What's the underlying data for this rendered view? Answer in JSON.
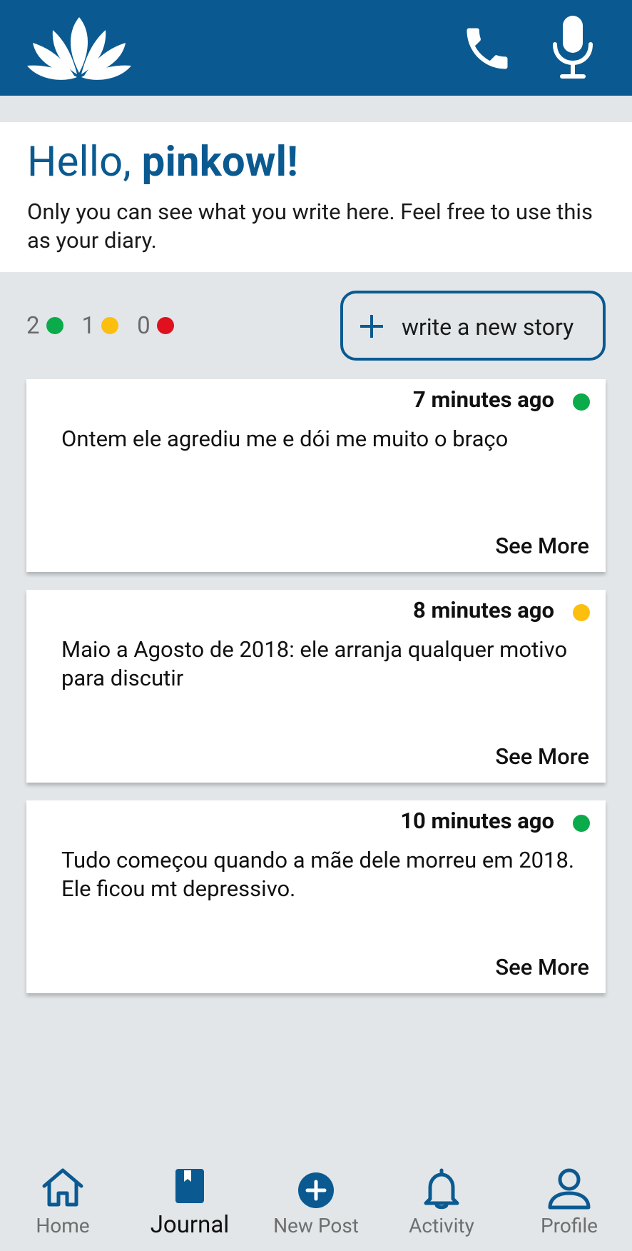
{
  "colors": {
    "brand": "#0a5a91",
    "background": "#e2e6e9",
    "green": "#0bab4b",
    "yellow": "#fcbf0f",
    "red": "#e0101e"
  },
  "header": {
    "logo_icon": "lotus-icon",
    "call_icon": "phone-icon",
    "voice_icon": "microphone-icon"
  },
  "greeting": {
    "hello": "Hello, ",
    "username": "pinkowl!",
    "subtitle": "Only you can see what you write here. Feel free to use this as your diary."
  },
  "counters": [
    {
      "count": "2",
      "color": "green"
    },
    {
      "count": "1",
      "color": "yellow"
    },
    {
      "count": "0",
      "color": "red"
    }
  ],
  "new_story": {
    "icon": "plus-icon",
    "label": "write a new story"
  },
  "stories": [
    {
      "time": "7 minutes ago",
      "status": "green",
      "text": "Ontem ele agrediu me e dói me muito o braço",
      "more": "See More"
    },
    {
      "time": "8 minutes ago",
      "status": "yellow",
      "text": "Maio a Agosto de 2018: ele arranja qualquer motivo para discutir",
      "more": "See More"
    },
    {
      "time": "10 minutes ago",
      "status": "green",
      "text": "Tudo começou quando a mãe dele morreu em 2018. Ele ficou mt depressivo.",
      "more": "See More"
    }
  ],
  "nav": [
    {
      "label": "Home",
      "icon": "home-icon"
    },
    {
      "label": "Journal",
      "icon": "journal-icon",
      "active": true
    },
    {
      "label": "New Post",
      "icon": "plus-circle-icon"
    },
    {
      "label": "Activity",
      "icon": "bell-icon"
    },
    {
      "label": "Profile",
      "icon": "user-icon"
    }
  ]
}
